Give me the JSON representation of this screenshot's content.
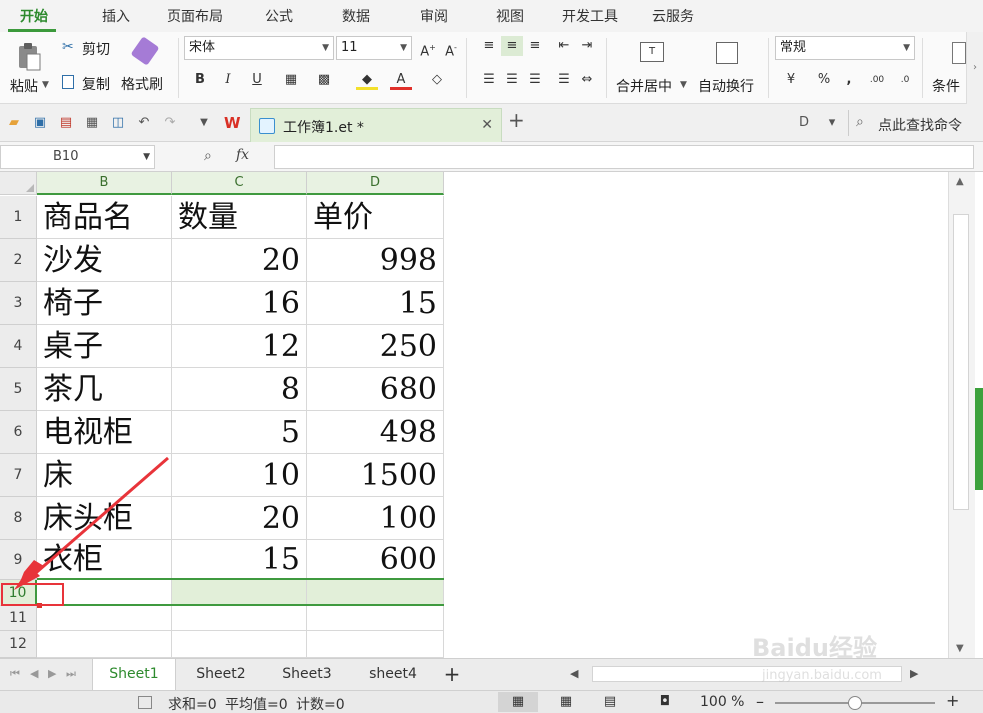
{
  "menu": {
    "tabs": [
      "开始",
      "插入",
      "页面布局",
      "公式",
      "数据",
      "审阅",
      "视图",
      "开发工具",
      "云服务"
    ],
    "active_index": 0
  },
  "ribbon": {
    "paste": "粘贴",
    "cut": "剪切",
    "copy": "复制",
    "format_painter": "格式刷",
    "font_name": "宋体",
    "font_size": "11",
    "bold": "B",
    "italic": "I",
    "underline": "U",
    "merge_center": "合并居中",
    "wrap_text": "自动换行",
    "number_format": "常规",
    "percent": "%",
    "comma": ",",
    "increase_decimal": ".00",
    "conditional": "条件"
  },
  "document": {
    "tab_name": "工作簿1.et *",
    "search_command": "点此查找命令"
  },
  "formula_bar": {
    "name_box": "B10",
    "fx": "fx",
    "formula": ""
  },
  "sheet": {
    "columns": [
      "B",
      "C",
      "D"
    ],
    "rows": [
      {
        "num": "1",
        "name": "商品名",
        "qty": "数量",
        "price": "单价"
      },
      {
        "num": "2",
        "name": "沙发",
        "qty": "20",
        "price": "998"
      },
      {
        "num": "3",
        "name": "椅子",
        "qty": "16",
        "price": "15"
      },
      {
        "num": "4",
        "name": "桌子",
        "qty": "12",
        "price": "250"
      },
      {
        "num": "5",
        "name": "茶几",
        "qty": "8",
        "price": "680"
      },
      {
        "num": "6",
        "name": "电视柜",
        "qty": "5",
        "price": "498"
      },
      {
        "num": "7",
        "name": "床",
        "qty": "10",
        "price": "1500"
      },
      {
        "num": "8",
        "name": "床头柜",
        "qty": "20",
        "price": "100"
      },
      {
        "num": "9",
        "name": "衣柜",
        "qty": "15",
        "price": "600"
      }
    ],
    "empty_rows": [
      "10",
      "11",
      "12"
    ],
    "selected_row": "10"
  },
  "sheet_tabs": [
    "Sheet1",
    "Sheet2",
    "Sheet3",
    "sheet4"
  ],
  "add_sheet": "+",
  "status": {
    "sum": "求和=0",
    "average": "平均值=0",
    "count": "计数=0",
    "zoom": "100 %"
  },
  "watermark": {
    "brand": "Baidu经验",
    "url": "jingyan.baidu.com"
  },
  "colors": {
    "accent_green": "#3f9a3f",
    "selection_fill": "#e2efd9",
    "annotation_red": "#e8343a"
  }
}
